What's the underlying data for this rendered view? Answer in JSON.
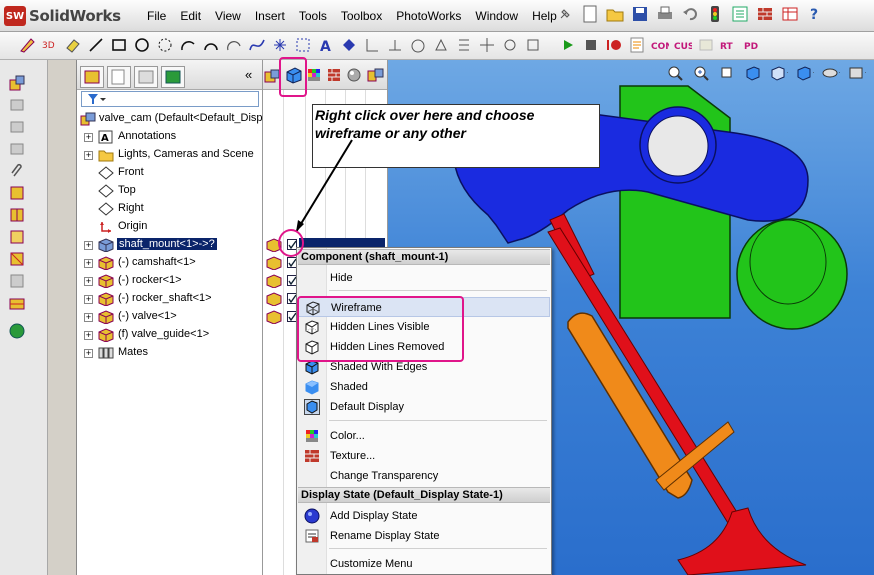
{
  "app": {
    "logo_badge": "SW",
    "logo_name": "SolidWorks"
  },
  "menu": [
    "File",
    "Edit",
    "View",
    "Insert",
    "Tools",
    "Toolbox",
    "PhotoWorks",
    "Window",
    "Help"
  ],
  "tree": {
    "root": "valve_cam  (Default<Default_Disp",
    "items": [
      {
        "label": "Annotations",
        "icon": "annotations-icon",
        "expand": "+"
      },
      {
        "label": "Lights, Cameras and Scene",
        "icon": "lights-folder-icon",
        "expand": "+"
      },
      {
        "label": "Front",
        "icon": "plane-icon",
        "expand": ""
      },
      {
        "label": "Top",
        "icon": "plane-icon",
        "expand": ""
      },
      {
        "label": "Right",
        "icon": "plane-icon",
        "expand": ""
      },
      {
        "label": "Origin",
        "icon": "origin-icon",
        "expand": ""
      },
      {
        "label": "shaft_mount<1>->?",
        "icon": "component-icon",
        "expand": "+",
        "selected": true
      },
      {
        "label": "(-) camshaft<1>",
        "icon": "part-icon",
        "expand": "+"
      },
      {
        "label": "(-) rocker<1>",
        "icon": "part-icon",
        "expand": "+"
      },
      {
        "label": "(-) rocker_shaft<1>",
        "icon": "part-icon",
        "expand": "+"
      },
      {
        "label": "(-) valve<1>",
        "icon": "part-icon",
        "expand": "+"
      },
      {
        "label": "(f) valve_guide<1>",
        "icon": "part-icon",
        "expand": "+"
      },
      {
        "label": "Mates",
        "icon": "mates-icon",
        "expand": "+"
      }
    ]
  },
  "callout": {
    "line1": "Right click over here and choose",
    "line2": "wireframe or any other"
  },
  "context_menu": {
    "header1": "Component (shaft_mount-1)",
    "hide": "Hide",
    "wireframe": "Wireframe",
    "hidden_lines_visible": "Hidden Lines Visible",
    "hidden_lines_removed": "Hidden Lines Removed",
    "shaded_with_edges": "Shaded With Edges",
    "shaded": "Shaded",
    "default_display": "Default Display",
    "color": "Color...",
    "texture": "Texture...",
    "change_transparency": "Change Transparency",
    "header2": "Display State (Default_Display State-1)",
    "add_display_state": "Add Display State",
    "rename_display_state": "Rename Display State",
    "customize_menu": "Customize Menu"
  },
  "colors": {
    "highlight": "#e0158a",
    "viewport_bg": "#3d82d6",
    "rocker": "#1a2be0",
    "mount": "#22c41a",
    "valve": "#e0101a",
    "guide": "#e07a10"
  }
}
